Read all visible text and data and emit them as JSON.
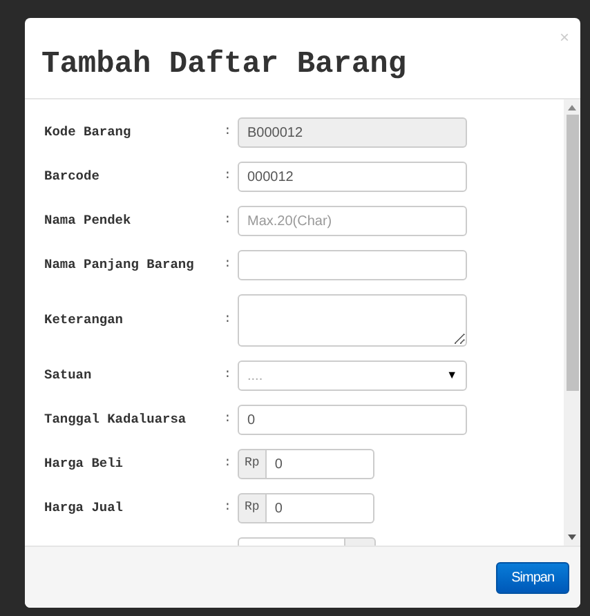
{
  "modal": {
    "title": "Tambah Daftar Barang",
    "close": "×"
  },
  "fields": [
    {
      "kind": "readonly",
      "label": "Kode Barang",
      "colon": ":",
      "value": "B000012"
    },
    {
      "kind": "text",
      "label": "Barcode",
      "colon": ":",
      "value": "000012"
    },
    {
      "kind": "text",
      "label": "Nama Pendek",
      "colon": ":",
      "placeholder": "Max.20(Char)"
    },
    {
      "kind": "text",
      "label": "Nama Panjang Barang",
      "colon": ":"
    },
    {
      "kind": "textarea",
      "label": "Keterangan",
      "colon": ":"
    },
    {
      "kind": "select",
      "label": "Satuan",
      "colon": ":",
      "placeholder": "....",
      "caret": "▼"
    },
    {
      "kind": "text",
      "label": "Tanggal Kadaluarsa",
      "colon": ":",
      "value": "0"
    },
    {
      "kind": "prefix",
      "label": "Harga Beli",
      "colon": ":",
      "addon": "Rp",
      "value": "0"
    },
    {
      "kind": "prefix",
      "label": "Harga Jual",
      "colon": ":",
      "addon": "Rp",
      "value": "0"
    },
    {
      "kind": "suffix"
    }
  ],
  "footer": {
    "buttons": [
      "Simpan"
    ]
  }
}
